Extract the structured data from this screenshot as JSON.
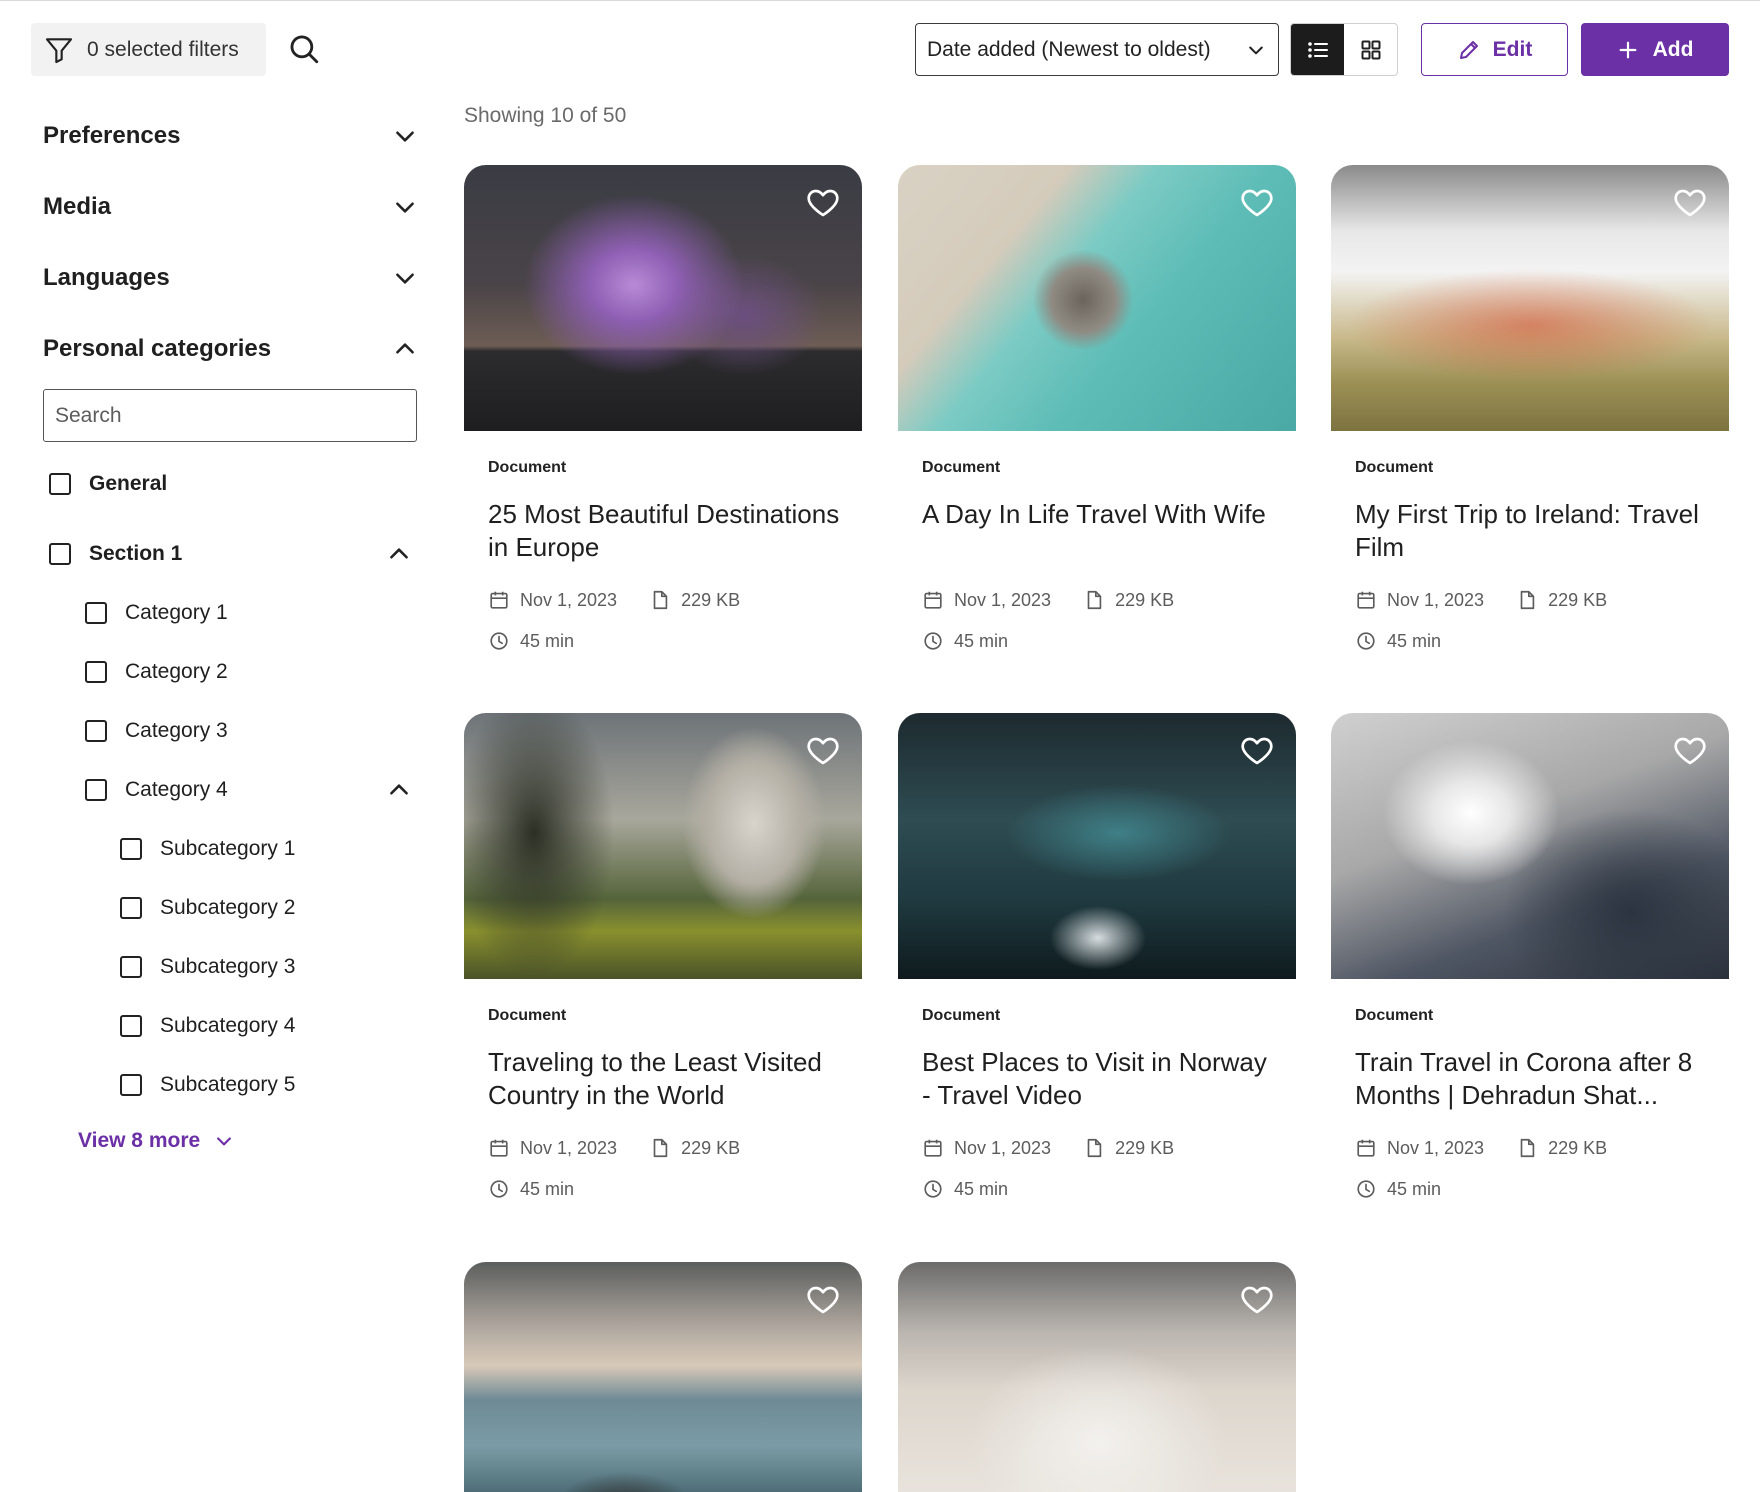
{
  "toolbar": {
    "filters_label": "0 selected filters",
    "sort_label": "Date added (Newest to oldest)",
    "edit_label": "Edit",
    "add_label": "Add"
  },
  "sidebar": {
    "sections": [
      "Preferences",
      "Media",
      "Languages",
      "Personal categories"
    ],
    "search_placeholder": "Search",
    "general_label": "General",
    "section1_label": "Section 1",
    "categories": [
      "Category 1",
      "Category 2",
      "Category 3",
      "Category 4"
    ],
    "subcategories": [
      "Subcategory 1",
      "Subcategory 2",
      "Subcategory 3",
      "Subcategory 4",
      "Subcategory 5"
    ],
    "view_more_label": "View 8 more"
  },
  "main": {
    "showing_label": "Showing 10 of 50",
    "cards": [
      {
        "type": "Document",
        "title": "25 Most Beautiful Destinations in Europe",
        "date": "Nov 1, 2023",
        "size": "229 KB",
        "duration": "45 min"
      },
      {
        "type": "Document",
        "title": "A Day In Life Travel With Wife",
        "date": "Nov 1, 2023",
        "size": "229 KB",
        "duration": "45 min"
      },
      {
        "type": "Document",
        "title": "My First Trip to Ireland: Travel Film",
        "date": "Nov 1, 2023",
        "size": "229 KB",
        "duration": "45 min"
      },
      {
        "type": "Document",
        "title": "Traveling to the Least Visited Country in the World",
        "date": "Nov 1, 2023",
        "size": "229 KB",
        "duration": "45 min"
      },
      {
        "type": "Document",
        "title": "Best Places to Visit in Norway - Travel Video",
        "date": "Nov 1, 2023",
        "size": "229 KB",
        "duration": "45 min"
      },
      {
        "type": "Document",
        "title": "Train Travel in Corona after 8 Months | Dehradun Shat...",
        "date": "Nov 1, 2023",
        "size": "229 KB",
        "duration": "45 min"
      },
      {
        "type": "",
        "title": "",
        "date": "",
        "size": "",
        "duration": ""
      },
      {
        "type": "",
        "title": "",
        "date": "",
        "size": "",
        "duration": ""
      }
    ]
  },
  "colors": {
    "accent": "#6b2fa6",
    "text": "#1f1f1f",
    "muted": "#5c5c5c"
  }
}
